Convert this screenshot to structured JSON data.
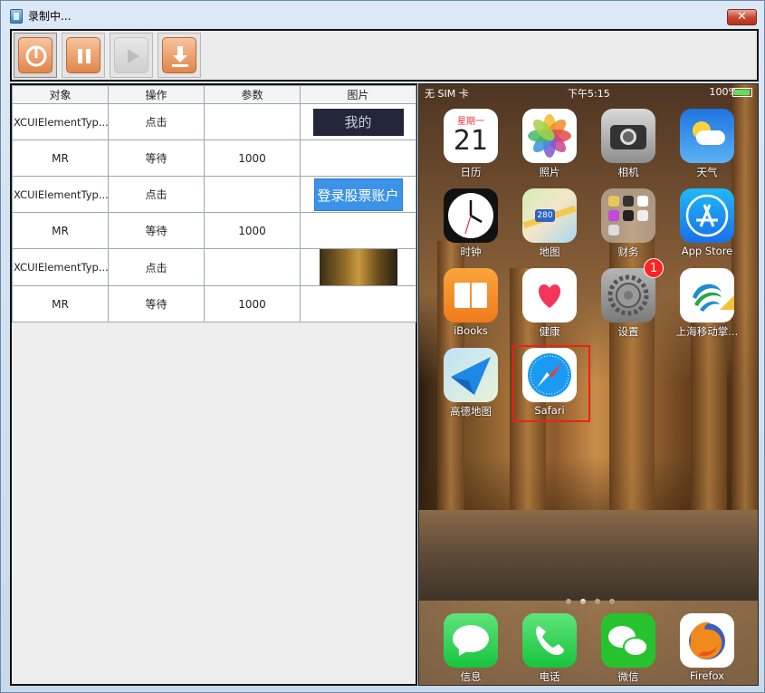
{
  "window": {
    "title": "录制中...",
    "close_label": "✕"
  },
  "toolbar": {
    "buttons": [
      "stop",
      "pause",
      "play",
      "download"
    ]
  },
  "table": {
    "headers": [
      "对象",
      "操作",
      "参数",
      "图片"
    ],
    "rows": [
      {
        "object": "XCUIElementTyp...",
        "action": "点击",
        "param": "",
        "image_text": "我的"
      },
      {
        "object": "MR",
        "action": "等待",
        "param": "1000",
        "image_text": ""
      },
      {
        "object": "XCUIElementTyp...",
        "action": "点击",
        "param": "",
        "image_text": "登录股票账户"
      },
      {
        "object": "MR",
        "action": "等待",
        "param": "1000",
        "image_text": ""
      },
      {
        "object": "XCUIElementTyp...",
        "action": "点击",
        "param": "",
        "image_text": ""
      },
      {
        "object": "MR",
        "action": "等待",
        "param": "1000",
        "image_text": ""
      }
    ]
  },
  "phone": {
    "status": {
      "carrier": "无 SIM 卡",
      "time": "下午5:15",
      "battery": "100%"
    },
    "calendar": {
      "weekday": "星期一",
      "day": "21"
    },
    "apps": [
      {
        "label": "日历",
        "icon": "calendar-icon"
      },
      {
        "label": "照片",
        "icon": "photos-icon"
      },
      {
        "label": "相机",
        "icon": "camera-icon"
      },
      {
        "label": "天气",
        "icon": "weather-icon"
      },
      {
        "label": "时钟",
        "icon": "clock-icon"
      },
      {
        "label": "地图",
        "icon": "maps-icon",
        "sign": "280"
      },
      {
        "label": "财务",
        "icon": "folder-icon"
      },
      {
        "label": "App Store",
        "icon": "appstore-icon"
      },
      {
        "label": "iBooks",
        "icon": "ibooks-icon"
      },
      {
        "label": "健康",
        "icon": "health-icon"
      },
      {
        "label": "设置",
        "icon": "settings-icon",
        "badge": "1"
      },
      {
        "label": "上海移动掌...",
        "icon": "china-mobile-icon"
      },
      {
        "label": "高德地图",
        "icon": "amap-icon"
      },
      {
        "label": "Safari",
        "icon": "safari-icon"
      }
    ],
    "dock": [
      {
        "label": "信息",
        "icon": "messages-icon"
      },
      {
        "label": "电话",
        "icon": "phone-icon"
      },
      {
        "label": "微信",
        "icon": "wechat-icon"
      },
      {
        "label": "Firefox",
        "icon": "firefox-icon"
      }
    ],
    "page_dots": {
      "count": 4,
      "active": 1
    }
  }
}
